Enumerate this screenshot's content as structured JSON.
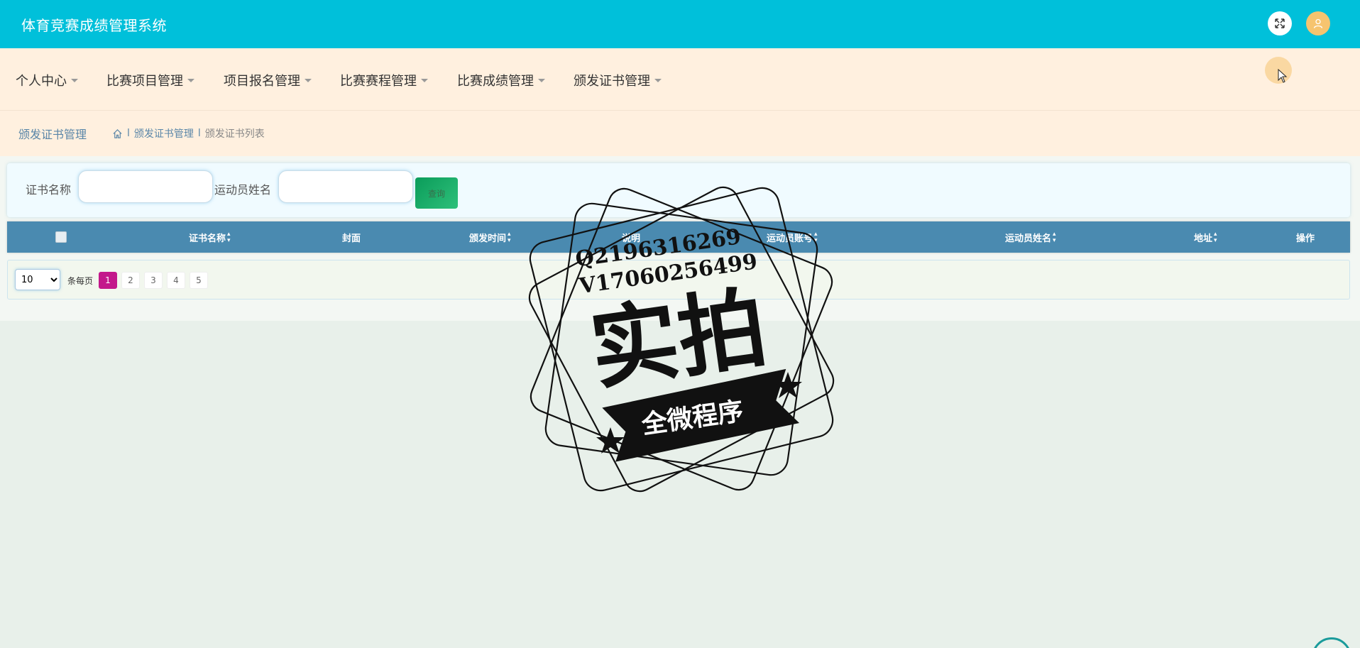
{
  "app": {
    "title": "体育竞赛成绩管理系统"
  },
  "header": {
    "fullscreen_icon": "expand-icon",
    "user_icon": "user-icon"
  },
  "nav": {
    "items": [
      {
        "label": "个人中心"
      },
      {
        "label": "比赛项目管理"
      },
      {
        "label": "项目报名管理"
      },
      {
        "label": "比赛赛程管理"
      },
      {
        "label": "比赛成绩管理"
      },
      {
        "label": "颁发证书管理"
      }
    ]
  },
  "breadcrumb": {
    "page_title": "颁发证书管理",
    "home_icon": "home-icon",
    "separator": "l",
    "level1": "颁发证书管理",
    "level2": "颁发证书列表"
  },
  "search": {
    "cert_name_label": "证书名称",
    "cert_name_value": "",
    "athlete_name_label": "运动员姓名",
    "athlete_name_value": "",
    "search_button": "查询"
  },
  "table": {
    "columns": [
      {
        "label": "证书名称",
        "sortable": true
      },
      {
        "label": "封面",
        "sortable": false
      },
      {
        "label": "颁发时间",
        "sortable": true
      },
      {
        "label": "说明",
        "sortable": false
      },
      {
        "label": "运动员账号",
        "sortable": true
      },
      {
        "label": "运动员姓名",
        "sortable": true
      },
      {
        "label": "地址",
        "sortable": true
      },
      {
        "label": "操作",
        "sortable": false
      }
    ],
    "rows": []
  },
  "pagination": {
    "page_size": "10",
    "page_size_options": [
      "10"
    ],
    "per_page_label": "条每页",
    "pages": [
      "1",
      "2",
      "3",
      "4",
      "5"
    ],
    "current_page": "1"
  },
  "watermark": {
    "line1": "Q2196316269",
    "line2": "V17060256499",
    "main_text": "实拍",
    "ribbon_text": "全微程序"
  },
  "colors": {
    "topbar": "#00c0da",
    "navbar": "#fff0df",
    "table_header": "#4a8ab0",
    "active_page": "#c3188b",
    "search_button": "#0a9c5a"
  }
}
